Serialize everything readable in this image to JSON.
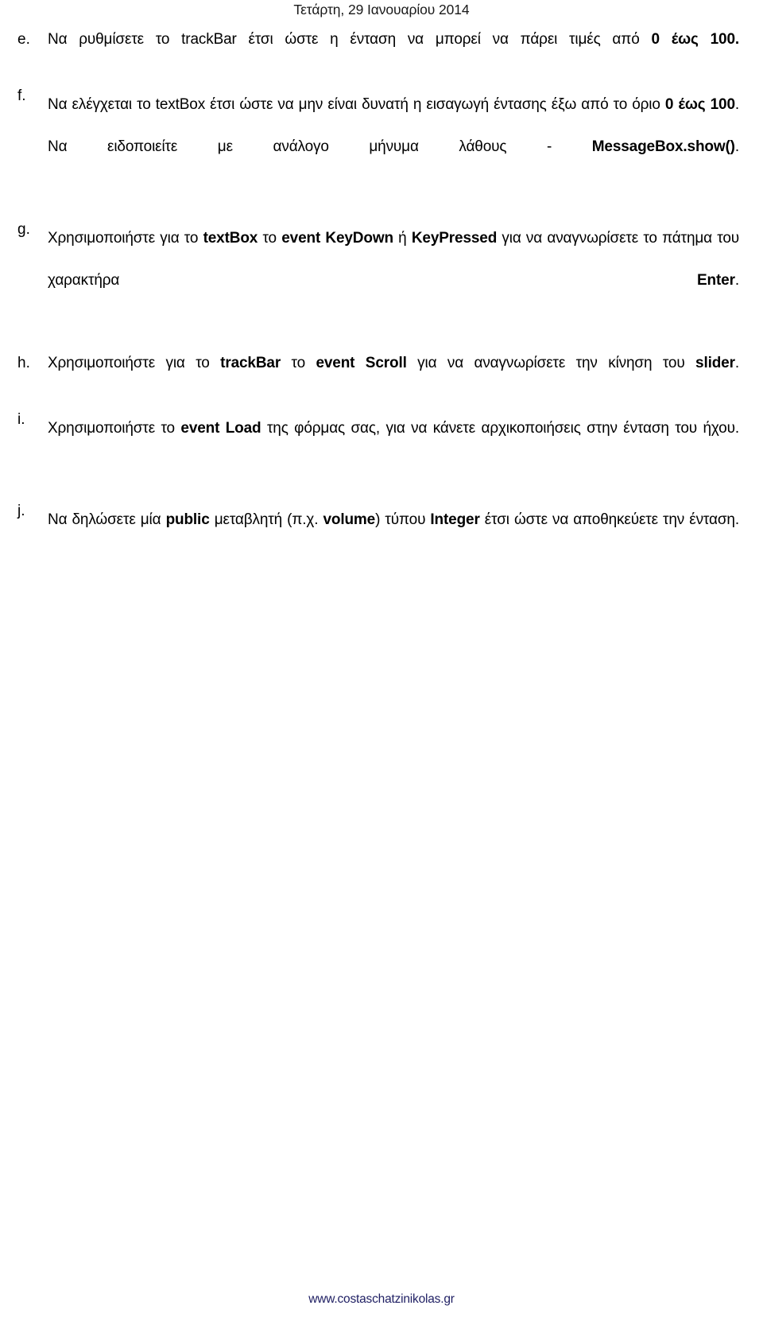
{
  "header": {
    "date": "Τετάρτη, 29 Ιανουαρίου 2014"
  },
  "footer": {
    "url": "www.costaschatzinikolas.gr",
    "color": "#1f1f63"
  },
  "list": {
    "items": [
      {
        "marker": "e.",
        "plain_text": "Να ρυθμίσετε το trackBar έτσι ώστε η ένταση να μπορεί να πάρει τιμές από 0 έως 100.",
        "runs": [
          {
            "text": "Να ρυθμίσετε το trackBar έτσι ώστε η ένταση να μπορεί να πάρει τιμές από ",
            "bold": false
          },
          {
            "text": "0 έως 100.",
            "bold": true
          }
        ]
      },
      {
        "marker": "f.",
        "plain_text": "Να ελέγχεται το textBox έτσι ώστε να μην είναι δυνατή η εισαγωγή έντασης έξω από το όριο 0 έως 100. Να ειδοποιείτε με ανάλογο μήνυμα λάθους - MessageBox.show().",
        "runs": [
          {
            "text": "Να ελέγχεται το textBox έτσι ώστε να μην είναι δυνατή η εισαγωγή έντασης έξω από το όριο ",
            "bold": false
          },
          {
            "text": "0 έως 100",
            "bold": true
          },
          {
            "text": ". Να ειδοποιείτε με ανάλογο μήνυμα λάθους - ",
            "bold": false
          },
          {
            "text": "MessageBox.show()",
            "bold": true
          },
          {
            "text": ".",
            "bold": false
          }
        ]
      },
      {
        "marker": "g.",
        "plain_text": "Χρησιμοποιήστε για το textBox το event KeyDown ή KeyPressed για να αναγνωρίσετε το πάτημα του χαρακτήρα Enter.",
        "runs": [
          {
            "text": "Χρησιμοποιήστε για το ",
            "bold": false
          },
          {
            "text": "textBox",
            "bold": true
          },
          {
            "text": " το ",
            "bold": false
          },
          {
            "text": "event KeyDown",
            "bold": true
          },
          {
            "text": " ή ",
            "bold": false
          },
          {
            "text": "KeyPressed",
            "bold": true
          },
          {
            "text": " για να αναγνωρίσετε το πάτημα του χαρακτήρα ",
            "bold": false
          },
          {
            "text": "Enter",
            "bold": true
          },
          {
            "text": ".",
            "bold": false
          }
        ]
      },
      {
        "marker": "h.",
        "plain_text": "Χρησιμοποιήστε για το trackBar το event Scroll για να αναγνωρίσετε την κίνηση του slider.",
        "runs": [
          {
            "text": "Χρησιμοποιήστε για το ",
            "bold": false
          },
          {
            "text": "trackBar",
            "bold": true
          },
          {
            "text": " το ",
            "bold": false
          },
          {
            "text": "event Scroll",
            "bold": true
          },
          {
            "text": " για να αναγνωρίσετε την κίνηση του ",
            "bold": false
          },
          {
            "text": "slider",
            "bold": true
          },
          {
            "text": ".",
            "bold": false
          }
        ]
      },
      {
        "marker": "i.",
        "plain_text": "Χρησιμοποιήστε το event Load της φόρμας σας, για να κάνετε αρχικοποιήσεις στην ένταση του ήχου.",
        "runs": [
          {
            "text": "Χρησιμοποιήστε το ",
            "bold": false
          },
          {
            "text": "event Load",
            "bold": true
          },
          {
            "text": " της φόρμας σας, για να κάνετε αρχικοποιήσεις στην ένταση του ήχου.",
            "bold": false
          }
        ]
      },
      {
        "marker": "j.",
        "plain_text": "Να δηλώσετε μία public μεταβλητή (π.χ. volume) τύπου Integer έτσι ώστε να αποθηκεύετε την ένταση.",
        "runs": [
          {
            "text": "Να δηλώσετε μία ",
            "bold": false
          },
          {
            "text": "public",
            "bold": true
          },
          {
            "text": " μεταβλητή (π.χ. ",
            "bold": false
          },
          {
            "text": "volume",
            "bold": true
          },
          {
            "text": ") τύπου ",
            "bold": false
          },
          {
            "text": "Integer",
            "bold": true
          },
          {
            "text": " έτσι ώστε να αποθηκεύετε την ένταση.",
            "bold": false
          }
        ]
      }
    ]
  }
}
